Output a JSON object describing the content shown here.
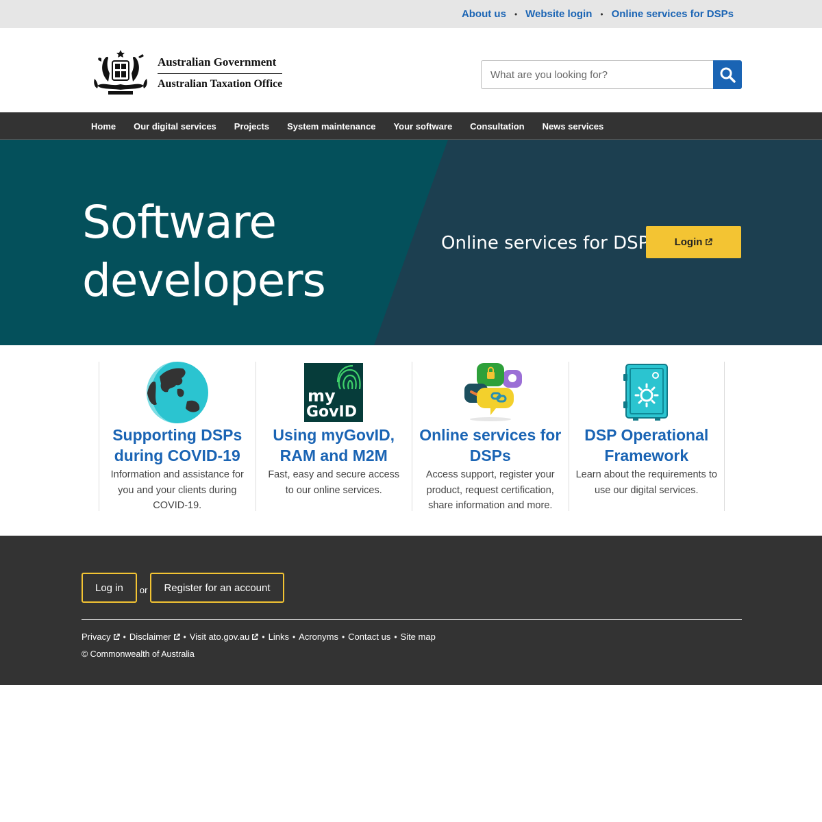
{
  "utility": {
    "links": [
      "About us",
      "Website login",
      "Online services for DSPs"
    ]
  },
  "header": {
    "logo_line1": "Australian Government",
    "logo_line2": "Australian Taxation Office",
    "search_placeholder": "What are you looking for?"
  },
  "nav": {
    "items": [
      "Home",
      "Our digital services",
      "Projects",
      "System maintenance",
      "Your software",
      "Consultation",
      "News services"
    ]
  },
  "hero": {
    "title_line1": "Software",
    "title_line2": "developers",
    "dsp_label": "Online services for DSPs",
    "login_label": "Login"
  },
  "cards": [
    {
      "title": "Supporting DSPs during COVID-19",
      "desc": "Information and assistance for you and your clients during COVID-19.",
      "icon": "globe-icon"
    },
    {
      "title": "Using myGovID, RAM and M2M",
      "desc": "Fast, easy and secure access to our online services.",
      "icon": "mygovid-logo-icon"
    },
    {
      "title": "Online services for DSPs",
      "desc": "Access support, register your product, request certification, share information and more.",
      "icon": "chat-bubbles-icon"
    },
    {
      "title": "DSP Operational Framework",
      "desc": "Learn about the requirements to use our digital services.",
      "icon": "safe-icon"
    }
  ],
  "mygovid_text": {
    "line1": "my",
    "line2": "GovID"
  },
  "footer": {
    "login_label": "Log in",
    "or_label": "or",
    "register_label": "Register for an account",
    "links": [
      "Privacy",
      "Disclaimer",
      "Visit ato.gov.au",
      "Links",
      "Acronyms",
      "Contact us",
      "Site map"
    ],
    "copyright": "© Commonwealth of Australia"
  },
  "colors": {
    "link_blue": "#1a64b4",
    "nav_bg": "#333333",
    "hero_teal": "#04505b",
    "hero_dark": "#1c3f50",
    "accent_yellow": "#f3c433",
    "footer_bg": "#333333"
  }
}
